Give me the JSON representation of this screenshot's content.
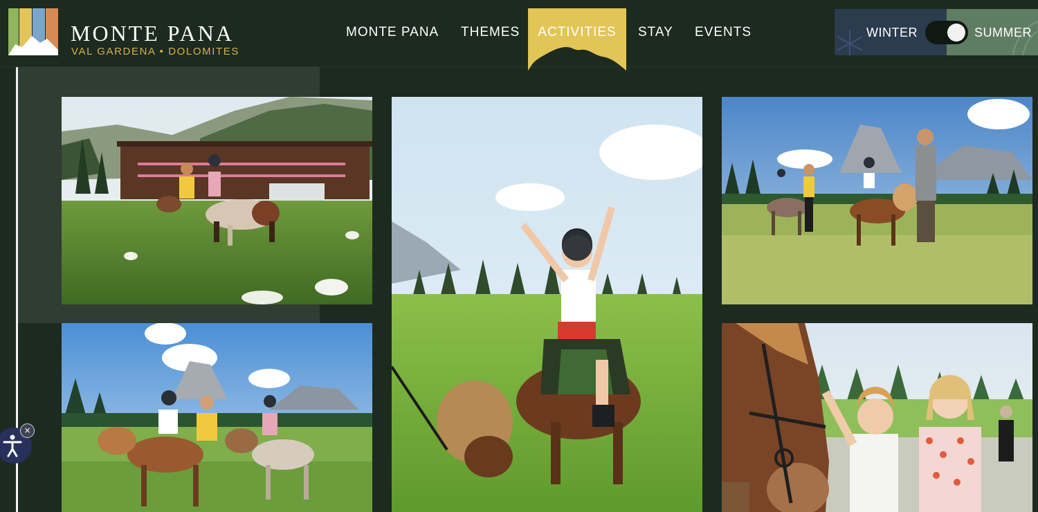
{
  "brand": {
    "title": "MONTE PANA",
    "subtitle": "VAL GARDENA • DOLOMITES",
    "colors": {
      "stripe_1": "#8fb55e",
      "stripe_2": "#e4c45a",
      "stripe_3": "#7aa7c9",
      "stripe_4": "#d78a55"
    }
  },
  "nav": {
    "items": [
      {
        "label": "MONTE PANA"
      },
      {
        "label": "THEMES"
      },
      {
        "label": "ACTIVITIES",
        "active": true
      },
      {
        "label": "STAY"
      },
      {
        "label": "EVENTS"
      }
    ],
    "active_color": "#e2c557"
  },
  "season": {
    "winter_label": "WINTER",
    "summer_label": "SUMMER",
    "selected": "SUMMER"
  },
  "gallery": {
    "photos": [
      {
        "subject": "children on pony in meadow in front of hotel"
      },
      {
        "subject": "boy with raised arms riding pony"
      },
      {
        "subject": "family walking ponies with mountains"
      },
      {
        "subject": "children riding ponies near peaks"
      },
      {
        "subject": "children petting a horse"
      }
    ]
  },
  "accessibility": {
    "icon": "accessibility-icon",
    "close_icon": "close-icon",
    "close_glyph": "×"
  },
  "colors": {
    "background": "#1d2a20",
    "header": "#1c2a1f",
    "winter": "#2b3c4f",
    "summer": "#5e7d62",
    "accessibility": "#27315c"
  }
}
